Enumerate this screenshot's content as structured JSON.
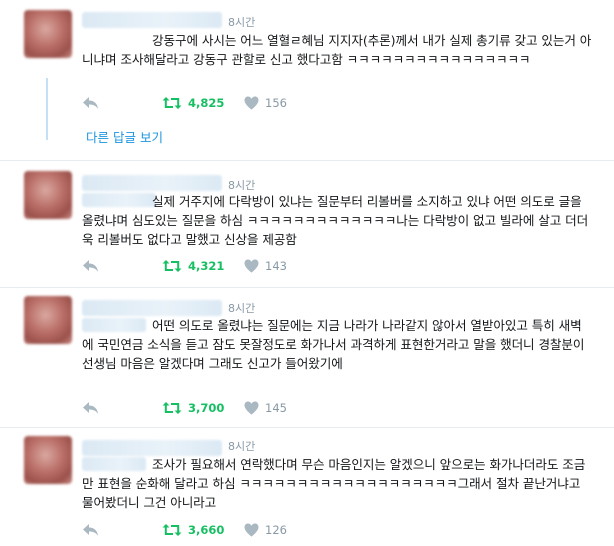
{
  "tweets": [
    {
      "time": "8시간",
      "text": "강동구에 사시는 어느 열혈ㄹ혜님 지지자(추론)께서 내가 실제 총기류 갖고 있는거 아니냐며 조사해달라고 강동구 관할로 신고 했다고함 ㅋㅋㅋㅋㅋㅋㅋㅋㅋㅋㅋㅋㅋㅋㅋㅋ",
      "retweets": "4,825",
      "likes": "156"
    },
    {
      "time": "8시간",
      "text": "실제 거주지에 다락방이 있냐는 질문부터 리볼버를 소지하고 있냐 어떤 의도로 글을 올렸냐며 심도있는 질문을 하심 ㅋㅋㅋㅋㅋㅋㅋㅋㅋㅋㅋㅋㅋ나는 다락방이 없고 빌라에 살고 더더욱 리볼버도 없다고 말했고 신상을 제공함",
      "retweets": "4,321",
      "likes": "143"
    },
    {
      "time": "8시간",
      "text": "어떤 의도로 올렸냐는 질문에는 지금 나라가 나라같지 않아서 열받아있고 특히 새벽에 국민연금 소식을 듣고 잠도 못잘정도로 화가나서 과격하게 표현한거라고 말을 했더니 경찰분이 선생님 마음은 알겠다며 그래도 신고가 들어왔기에",
      "retweets": "3,700",
      "likes": "145"
    },
    {
      "time": "8시간",
      "text": "조사가 필요해서 연락했다며 무슨 마음인지는 알겠으니 앞으로는 화가나더라도 조금만 표현을 순화해 달라고 하심 ㅋㅋㅋㅋㅋㅋㅋㅋㅋㅋㅋㅋㅋㅋㅋㅋㅋㅋㅋ그래서 절차 끝난거냐고 물어봤더니 그건 아니라고",
      "retweets": "3,660",
      "likes": "126"
    }
  ],
  "more_replies": "다른 답글 보기",
  "icons": {
    "reply": "reply-arrow-icon",
    "retweet": "retweet-icon",
    "like": "heart-icon"
  },
  "colors": {
    "retweet_active": "#17bf63",
    "link": "#1b95e0",
    "muted": "#8899a6",
    "thread_line": "#c5e0f5"
  }
}
